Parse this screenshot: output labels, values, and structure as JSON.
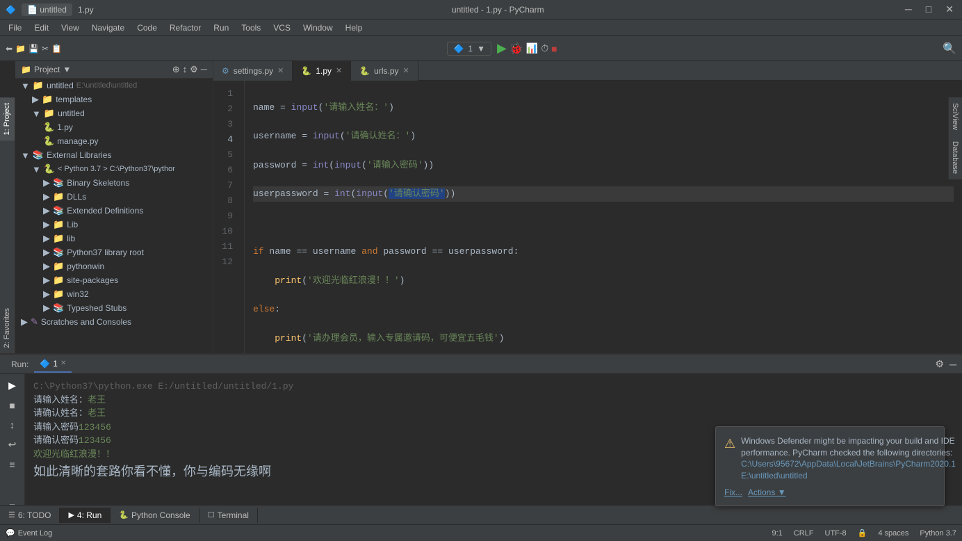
{
  "window": {
    "title": "untitled - 1.py - PyCharm",
    "tab_label": "untitled",
    "file_label": "1.py"
  },
  "menubar": {
    "items": [
      "File",
      "Edit",
      "View",
      "Navigate",
      "Code",
      "Refactor",
      "Run",
      "Tools",
      "VCS",
      "Window",
      "Help"
    ]
  },
  "toolbar": {
    "run_config": "1",
    "run_btn": "▶",
    "icons": [
      "run",
      "debug",
      "coverage",
      "profile",
      "stop",
      "build",
      "sync"
    ]
  },
  "tabs": {
    "open": [
      {
        "name": "settings.py",
        "icon": "⚙",
        "active": false
      },
      {
        "name": "1.py",
        "icon": "🐍",
        "active": true
      },
      {
        "name": "urls.py",
        "icon": "🐍",
        "active": false
      }
    ]
  },
  "sidebar": {
    "panel_title": "Project",
    "items": [
      {
        "label": "untitled",
        "path": "E:\\untitled\\untitled",
        "indent": 0,
        "type": "project"
      },
      {
        "label": "templates",
        "indent": 1,
        "type": "folder"
      },
      {
        "label": "untitled",
        "indent": 2,
        "type": "folder"
      },
      {
        "label": "1.py",
        "indent": 3,
        "type": "py"
      },
      {
        "label": "manage.py",
        "indent": 3,
        "type": "py"
      },
      {
        "label": "External Libraries",
        "indent": 1,
        "type": "lib"
      },
      {
        "label": "< Python 3.7 > C:\\Python37\\pythor",
        "indent": 2,
        "type": "python"
      },
      {
        "label": "Binary Skeletons",
        "indent": 3,
        "type": "lib"
      },
      {
        "label": "DLLs",
        "indent": 3,
        "type": "folder"
      },
      {
        "label": "Extended Definitions",
        "indent": 3,
        "type": "lib"
      },
      {
        "label": "Lib",
        "indent": 3,
        "type": "folder"
      },
      {
        "label": "lib",
        "indent": 3,
        "type": "folder"
      },
      {
        "label": "Python37 library root",
        "indent": 3,
        "type": "lib"
      },
      {
        "label": "pythonwin",
        "indent": 3,
        "type": "folder"
      },
      {
        "label": "site-packages",
        "indent": 3,
        "type": "folder"
      },
      {
        "label": "win32",
        "indent": 3,
        "type": "folder"
      },
      {
        "label": "Typeshed Stubs",
        "indent": 3,
        "type": "lib"
      },
      {
        "label": "Scratches and Consoles",
        "indent": 1,
        "type": "scratch"
      }
    ]
  },
  "code": {
    "lines": [
      {
        "num": 1,
        "content": "name = input('请输入姓名：')"
      },
      {
        "num": 2,
        "content": "username = input('请确认姓名：')"
      },
      {
        "num": 3,
        "content": "password = int(input('请输入密码'))"
      },
      {
        "num": 4,
        "content": "userpassword = int(input('请确认密码'))",
        "highlighted": true
      },
      {
        "num": 5,
        "content": ""
      },
      {
        "num": 6,
        "content": "if name == username and password == userpassword:"
      },
      {
        "num": 7,
        "content": "    print('欢迎光临红浪漫！！')"
      },
      {
        "num": 8,
        "content": "else:"
      },
      {
        "num": 9,
        "content": "    print('请办理会员，输入专属邀请码，可便宜五毛钱')"
      },
      {
        "num": 10,
        "content": ""
      },
      {
        "num": 11,
        "content": ""
      },
      {
        "num": 12,
        "content": ""
      }
    ]
  },
  "run_panel": {
    "run_label": "Run:",
    "tab_name": "1",
    "console_lines": [
      {
        "text": "C:\\Python37\\python.exe E:/untitled/untitled/1.py",
        "type": "path"
      },
      {
        "text": "请输入姓名：",
        "type": "prompt",
        "user_input": "老王"
      },
      {
        "text": "请确认姓名：",
        "type": "prompt",
        "user_input": "老王"
      },
      {
        "text": "请输入密码",
        "type": "prompt",
        "user_input": "123456"
      },
      {
        "text": "请确认密码",
        "type": "prompt",
        "user_input": "123456"
      },
      {
        "text": "欢迎光临红浪漫！！",
        "type": "output"
      }
    ],
    "big_text": "如此清晰的套路你看不懂，你与编码无缘啊"
  },
  "notification": {
    "icon": "⚠",
    "title": "Windows Defender might be impacting your build and IDE performance. PyCharm checked the following directories:",
    "paths": [
      "C:\\Users\\95672\\AppData\\Local\\JetBrains\\PyCharm2020.1",
      "E:\\untitled\\untitled"
    ],
    "fix_label": "Fix...",
    "actions_label": "Actions"
  },
  "status_bar": {
    "position": "9:1",
    "line_ending": "CRLF",
    "encoding": "UTF-8",
    "indent": "4 spaces",
    "interpreter": "Python 3.7",
    "event_log": "Event Log"
  },
  "bottom_tabs": [
    {
      "label": "6: TODO",
      "icon": "☰",
      "active": false
    },
    {
      "label": "4: Run",
      "icon": "▶",
      "active": true
    },
    {
      "label": "Python Console",
      "icon": "🐍",
      "active": false
    },
    {
      "label": "Terminal",
      "icon": "☐",
      "active": false
    }
  ],
  "vtabs": [
    {
      "label": "1: Project",
      "active": true
    },
    {
      "label": "2: Favorites",
      "active": false
    }
  ],
  "rtabs": [
    {
      "label": "SciView"
    },
    {
      "label": "Database"
    }
  ]
}
